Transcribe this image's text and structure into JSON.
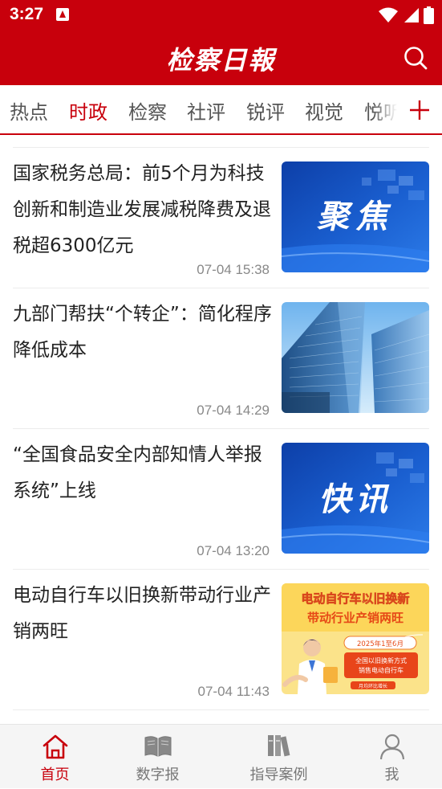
{
  "status": {
    "time": "3:27"
  },
  "app": {
    "title": "检察日報"
  },
  "tabs": [
    {
      "label": "热点"
    },
    {
      "label": "时政"
    },
    {
      "label": "检察"
    },
    {
      "label": "社评"
    },
    {
      "label": "锐评"
    },
    {
      "label": "视觉"
    },
    {
      "label": "悦听"
    }
  ],
  "active_tab": "时政",
  "articles": [
    {
      "title": "国家税务总局：前5个月为科技创新和制造业发展减税降费及退税超6300亿元",
      "time": "07-04 15:38",
      "thumb_text": "聚焦"
    },
    {
      "title": "九部门帮扶“个转企”：简化程序 降低成本",
      "time": "07-04 14:29",
      "thumb_text": ""
    },
    {
      "title": "“全国食品安全内部知情人举报系统”上线",
      "time": "07-04 13:20",
      "thumb_text": "快讯"
    },
    {
      "title": "电动自行车以旧换新带动行业产销两旺",
      "time": "07-04 11:43",
      "thumb_text": "电动自行车以旧换新",
      "thumb_text2": "带动行业产销两旺",
      "thumb_date": "2025年1至6月",
      "thumb_note1": "全国以旧换新方式",
      "thumb_note2": "销售电动自行车",
      "thumb_note3": "月均环比增长"
    }
  ],
  "nav": [
    {
      "label": "首页"
    },
    {
      "label": "数字报"
    },
    {
      "label": "指导案例"
    },
    {
      "label": "我"
    }
  ],
  "colors": {
    "brand": "#c8000c",
    "blue": "#1a5fd0"
  }
}
